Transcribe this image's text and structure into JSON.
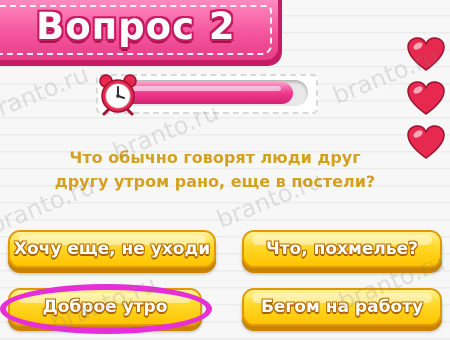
{
  "header": {
    "title": "Вопрос 2"
  },
  "timer": {
    "remaining_fraction": 0.93
  },
  "lives": {
    "count": 3,
    "icon": "heart-icon",
    "color": "#e8294f"
  },
  "question": {
    "line1": "Что обычно говорят люди друг",
    "line2": "другу утром рано, еще в постели?"
  },
  "answers": [
    {
      "label": "Хочу еще, не уходи",
      "selected": false
    },
    {
      "label": "Что, похмелье?",
      "selected": false
    },
    {
      "label": "Доброе утро",
      "selected": true
    },
    {
      "label": "Бегом на работу",
      "selected": false
    }
  ],
  "colors": {
    "ribbon": "#f4569d",
    "question_text": "#d3a020",
    "answer_button": "#ffd92b",
    "highlight": "#e62fd6"
  },
  "watermark": {
    "text": "branto.ru"
  }
}
